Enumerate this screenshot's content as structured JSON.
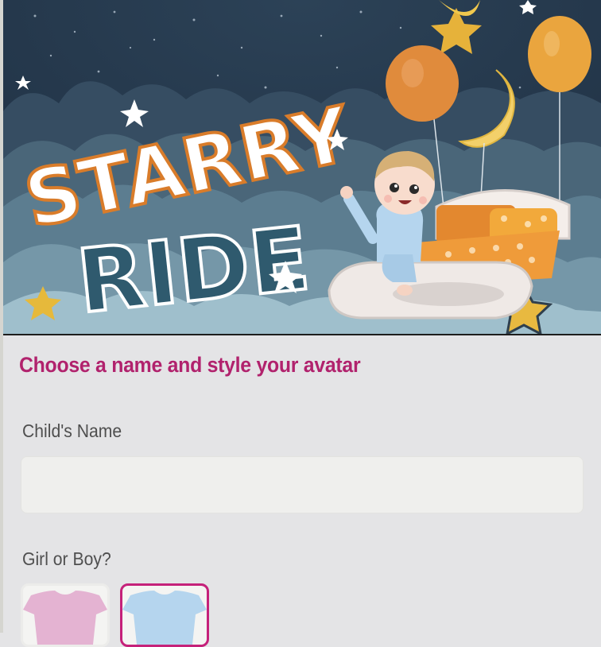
{
  "hero": {
    "title_line1": "STARRY",
    "title_line2": "RIDE",
    "colors": {
      "sky": "#233447",
      "clouds": "#6d8ea0",
      "title_fill": "#ffffff",
      "title_outline": "#d97c2a",
      "ride_fill": "#2f5a6e"
    }
  },
  "form": {
    "title": "Choose a name and style your avatar",
    "name_label": "Child's Name",
    "name_value": "",
    "name_placeholder": "",
    "gender_label": "Girl or Boy?",
    "gender_options": [
      {
        "option": "girl",
        "color": "#e4b3d2",
        "selected": false
      },
      {
        "option": "boy",
        "color": "#b5d5ee",
        "selected": true
      }
    ],
    "accent_color": "#b1226d"
  }
}
